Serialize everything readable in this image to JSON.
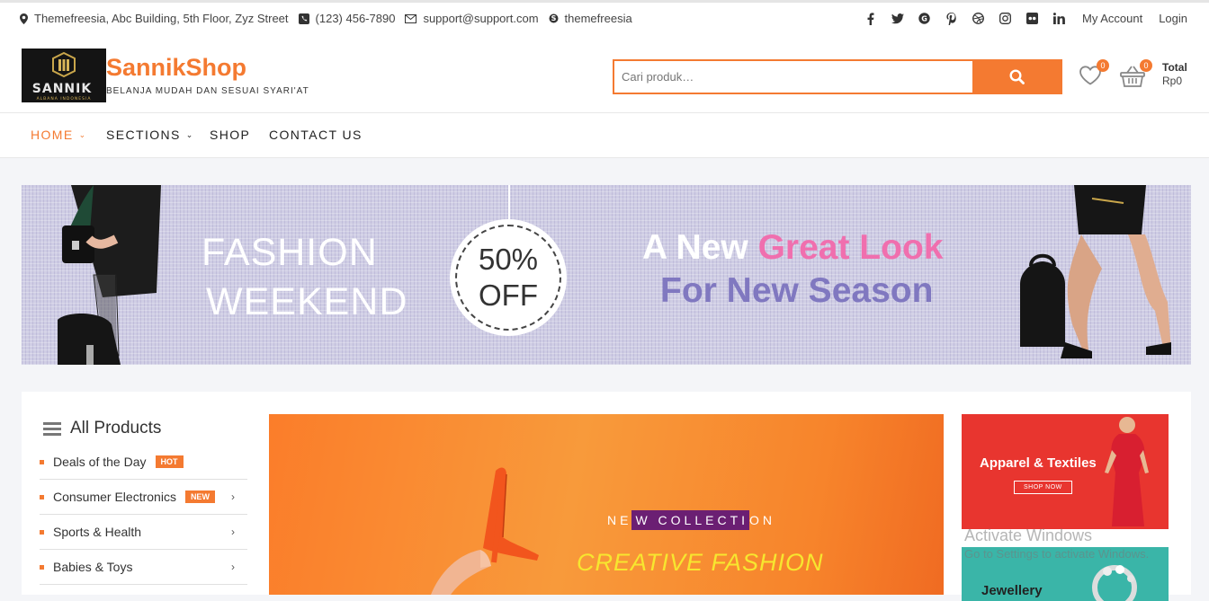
{
  "topbar": {
    "address": "Themefreesia, Abc Building, 5th Floor, Zyz Street",
    "phone": "(123) 456-7890",
    "email": "support@support.com",
    "skype": "themefreesia",
    "my_account": "My Account",
    "login": "Login",
    "social_icons": [
      "facebook-icon",
      "twitter-icon",
      "google-plus-icon",
      "pinterest-icon",
      "dribbble-icon",
      "instagram-icon",
      "flickr-icon",
      "linkedin-icon"
    ]
  },
  "header": {
    "logo_text": "SANNIK",
    "logo_subtext": "ALBANA INDONESIA",
    "site_title": "SannikShop",
    "tagline": "BELANJA MUDAH DAN SESUAI SYARI'AT",
    "search_placeholder": "Cari produk…",
    "wishlist_count": "0",
    "cart_count": "0",
    "total_label": "Total",
    "total_value": "Rp0"
  },
  "nav": {
    "items": [
      {
        "label": "HOME",
        "has_dropdown": true,
        "active": true
      },
      {
        "label": "SECTIONS",
        "has_dropdown": true,
        "active": false
      },
      {
        "label": "SHOP",
        "has_dropdown": false,
        "active": false
      },
      {
        "label": "CONTACT US",
        "has_dropdown": false,
        "active": false
      }
    ]
  },
  "banner": {
    "line1": "FASHION",
    "line2": "WEEKEND",
    "discount1": "50%",
    "discount2": "OFF",
    "tagline_a": "A New",
    "tagline_b": "Great Look",
    "tagline_c": "For New Season"
  },
  "sidebar": {
    "title": "All Products",
    "categories": [
      {
        "label": "Deals of the Day",
        "tag": "HOT"
      },
      {
        "label": "Consumer Electronics",
        "tag": "NEW"
      },
      {
        "label": "Sports & Health",
        "tag": ""
      },
      {
        "label": "Babies & Toys",
        "tag": ""
      }
    ]
  },
  "hero": {
    "line1_pre": "NE",
    "line1_mark": "W COLLECTI",
    "line1_post": "ON",
    "line2": "CREATIVE FASHION"
  },
  "promos": {
    "apparel_title": "Apparel & Textiles",
    "apparel_button": "SHOP NOW",
    "jewellery_title": "Jewellery"
  },
  "watermark": {
    "line1": "Activate Windows",
    "line2": "Go to Settings to activate Windows."
  },
  "colors": {
    "accent": "#f47a31",
    "banner_bg": "#cfcde4",
    "pink": "#f06fae",
    "purple": "#8078c0",
    "promo_red": "#e8352f",
    "promo_teal": "#3ab5a8"
  }
}
